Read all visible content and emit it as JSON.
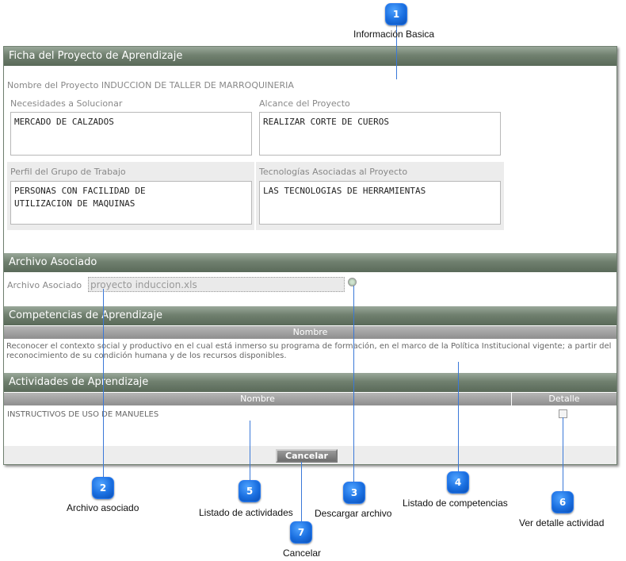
{
  "window_title": "Ficha del Proyecto de Aprendizaje",
  "project": {
    "name_line": "Nombre del Proyecto INDUCCION DE TALLER DE MARROQUINERIA",
    "fields": [
      {
        "label": "Necesidades a Solucionar",
        "value": "MERCADO DE CALZADOS"
      },
      {
        "label": "Alcance del Proyecto",
        "value": "REALIZAR CORTE DE CUEROS"
      },
      {
        "label": "Perfil del Grupo de Trabajo",
        "value": "PERSONAS CON FACILIDAD DE\nUTILIZACION DE MAQUINAS"
      },
      {
        "label": "Tecnologías Asociadas al Proyecto",
        "value": "LAS TECNOLOGIAS DE HERRAMIENTAS"
      }
    ]
  },
  "archivo": {
    "section_title": "Archivo Asociado",
    "label": "Archivo Asociado",
    "value": "proyecto induccion.xls"
  },
  "competencias": {
    "section_title": "Competencias de Aprendizaje",
    "column": "Nombre",
    "text": "Reconocer el contexto social y productivo en el cual está inmerso su programa de formación, en el marco de la Política Institucional vigente; a partir del reconocimiento de su condición humana y de los recursos disponibles."
  },
  "actividades": {
    "section_title": "Actividades de Aprendizaje",
    "columns": [
      "Nombre",
      "Detalle"
    ],
    "rows": [
      {
        "nombre": "INSTRUCTIVOS DE USO DE MANUELES"
      }
    ]
  },
  "cancel_label": "Cancelar",
  "callouts": [
    {
      "num": "1",
      "caption": "Información Basica"
    },
    {
      "num": "2",
      "caption": "Archivo asociado"
    },
    {
      "num": "3",
      "caption": "Descargar archivo"
    },
    {
      "num": "4",
      "caption": "Listado de competencias"
    },
    {
      "num": "5",
      "caption": "Listado de actividades"
    },
    {
      "num": "6",
      "caption": "Ver detalle actividad"
    },
    {
      "num": "7",
      "caption": "Cancelar"
    }
  ],
  "colors": {
    "header": "#70806f",
    "callout": "#1a6fe0"
  }
}
